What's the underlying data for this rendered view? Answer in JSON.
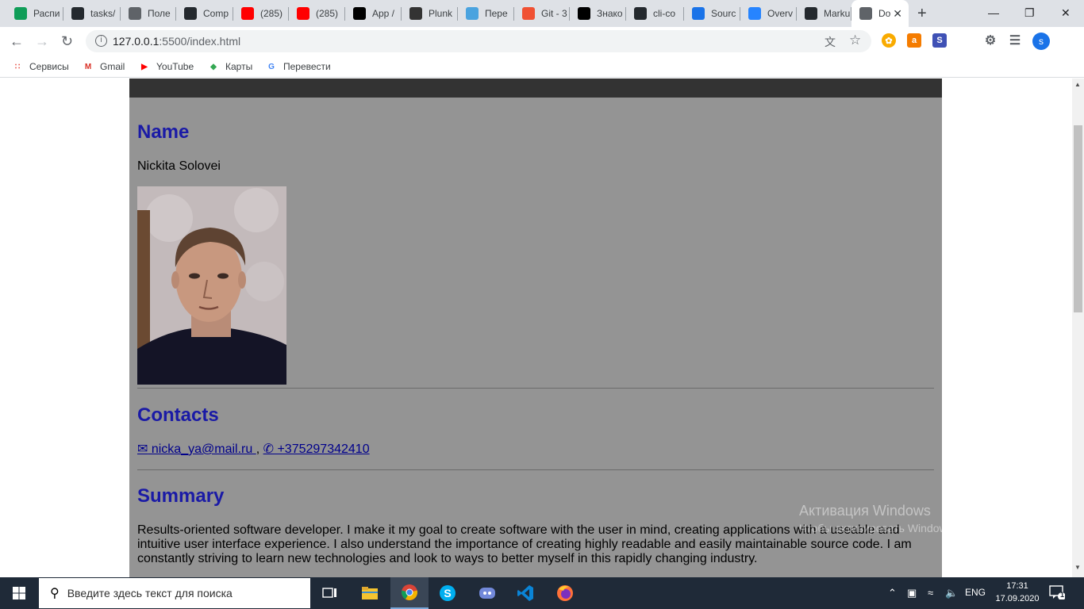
{
  "tabs": [
    {
      "title": "Распи",
      "icon": "sheets-icon",
      "color": "#0f9d58"
    },
    {
      "title": "tasks/",
      "icon": "github-icon",
      "color": "#24292e"
    },
    {
      "title": "Поле",
      "icon": "shield-icon",
      "color": "#5f6368"
    },
    {
      "title": "Comp",
      "icon": "github-icon",
      "color": "#24292e"
    },
    {
      "title": "(285)",
      "icon": "youtube-icon",
      "color": "#ff0000"
    },
    {
      "title": "(285)",
      "icon": "youtube-icon",
      "color": "#ff0000"
    },
    {
      "title": "App /",
      "icon": "rs-icon",
      "color": "#000000"
    },
    {
      "title": "Plunk",
      "icon": "download-icon",
      "color": "#333333"
    },
    {
      "title": "Пере",
      "icon": "translate-icon",
      "color": "#4aa3df"
    },
    {
      "title": "Git - 3",
      "icon": "git-icon",
      "color": "#f05133"
    },
    {
      "title": "Знако",
      "icon": "medium-icon",
      "color": "#000000"
    },
    {
      "title": "cli-co",
      "icon": "github-icon",
      "color": "#24292e"
    },
    {
      "title": "Sourc",
      "icon": "location-icon",
      "color": "#1a73e8"
    },
    {
      "title": "Overv",
      "icon": "bitbucket-icon",
      "color": "#2684ff"
    },
    {
      "title": "Marku",
      "icon": "github-icon",
      "color": "#24292e"
    },
    {
      "title": "Do",
      "icon": "globe-icon",
      "color": "#5f6368",
      "active": true
    }
  ],
  "url": {
    "host": "127.0.0.1",
    "path": ":5500/index.html"
  },
  "bookmarks": [
    {
      "label": "Сервисы",
      "icon": "apps-icon"
    },
    {
      "label": "Gmail",
      "icon": "gmail-icon"
    },
    {
      "label": "YouTube",
      "icon": "youtube-icon"
    },
    {
      "label": "Карты",
      "icon": "maps-icon"
    },
    {
      "label": "Перевести",
      "icon": "translate-icon"
    }
  ],
  "cv": {
    "name_heading": "Name",
    "name": "Nickita Solovei",
    "contacts_heading": "Contacts",
    "email": " nicka_ya@mail.ru ",
    "comma": ",",
    "phone": " +375297342410",
    "summary_heading": "Summary",
    "summary_lines": [
      "Results-oriented software developer. I make it my goal to create software with the user in mind, creating applications with a useable and",
      "intuitive user interface experience. I also understand the importance of creating highly readable and easily maintainable source code. I am",
      "constantly striving to learn new technologies and look to ways to better myself in this rapidly changing industry."
    ]
  },
  "watermark": {
    "line1": "Активация Windows",
    "line2": "Чтобы активировать Windows, перейдите в"
  },
  "taskbar": {
    "search_placeholder": "Введите здесь текст для поиска",
    "lang": "ENG",
    "time": "17:31",
    "date": "17.09.2020",
    "notifications": "1"
  }
}
